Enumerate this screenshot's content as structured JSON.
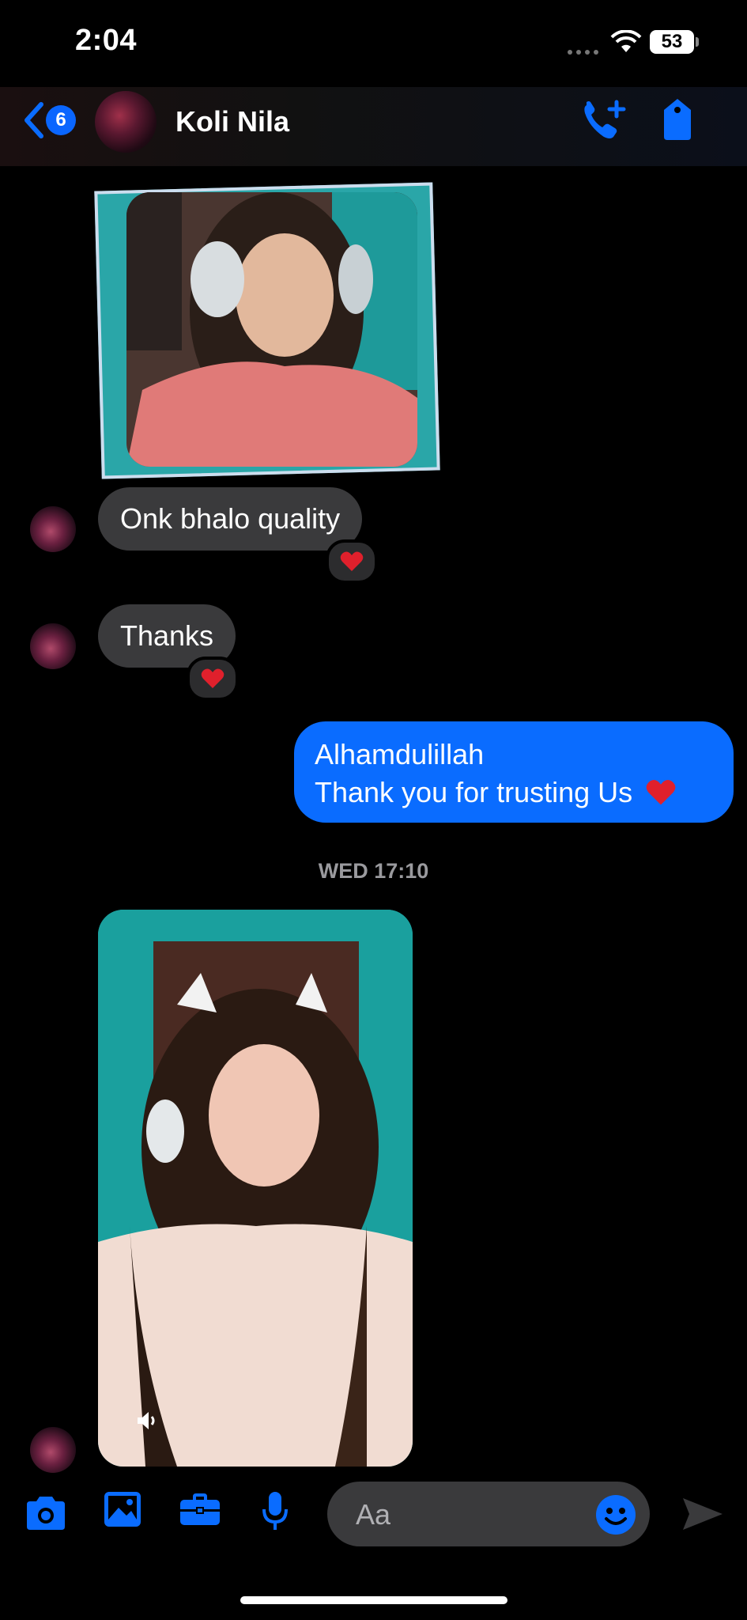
{
  "status_bar": {
    "time": "2:04",
    "battery": "53"
  },
  "header": {
    "back_count": "6",
    "contact_name": "Koli Nila"
  },
  "messages": {
    "in1": {
      "text": "Onk bhalo quality",
      "reaction": "heart"
    },
    "in2": {
      "text": "Thanks",
      "reaction": "heart"
    },
    "out1": {
      "line1": "Alhamdulillah",
      "line2": "Thank you for trusting Us"
    },
    "timestamp": "WED 17:10"
  },
  "composer": {
    "placeholder": "Aa"
  },
  "colors": {
    "accent": "#0a6cff",
    "incoming_bubble": "#3a3a3c",
    "reaction": "#e0202c"
  },
  "icons": [
    "signal-icon",
    "wifi-icon",
    "back-chevron-icon",
    "call-add-icon",
    "tag-icon",
    "heart-icon",
    "speaker-icon",
    "camera-icon",
    "image-icon",
    "toolbox-icon",
    "mic-icon",
    "emoji-icon",
    "send-icon"
  ]
}
